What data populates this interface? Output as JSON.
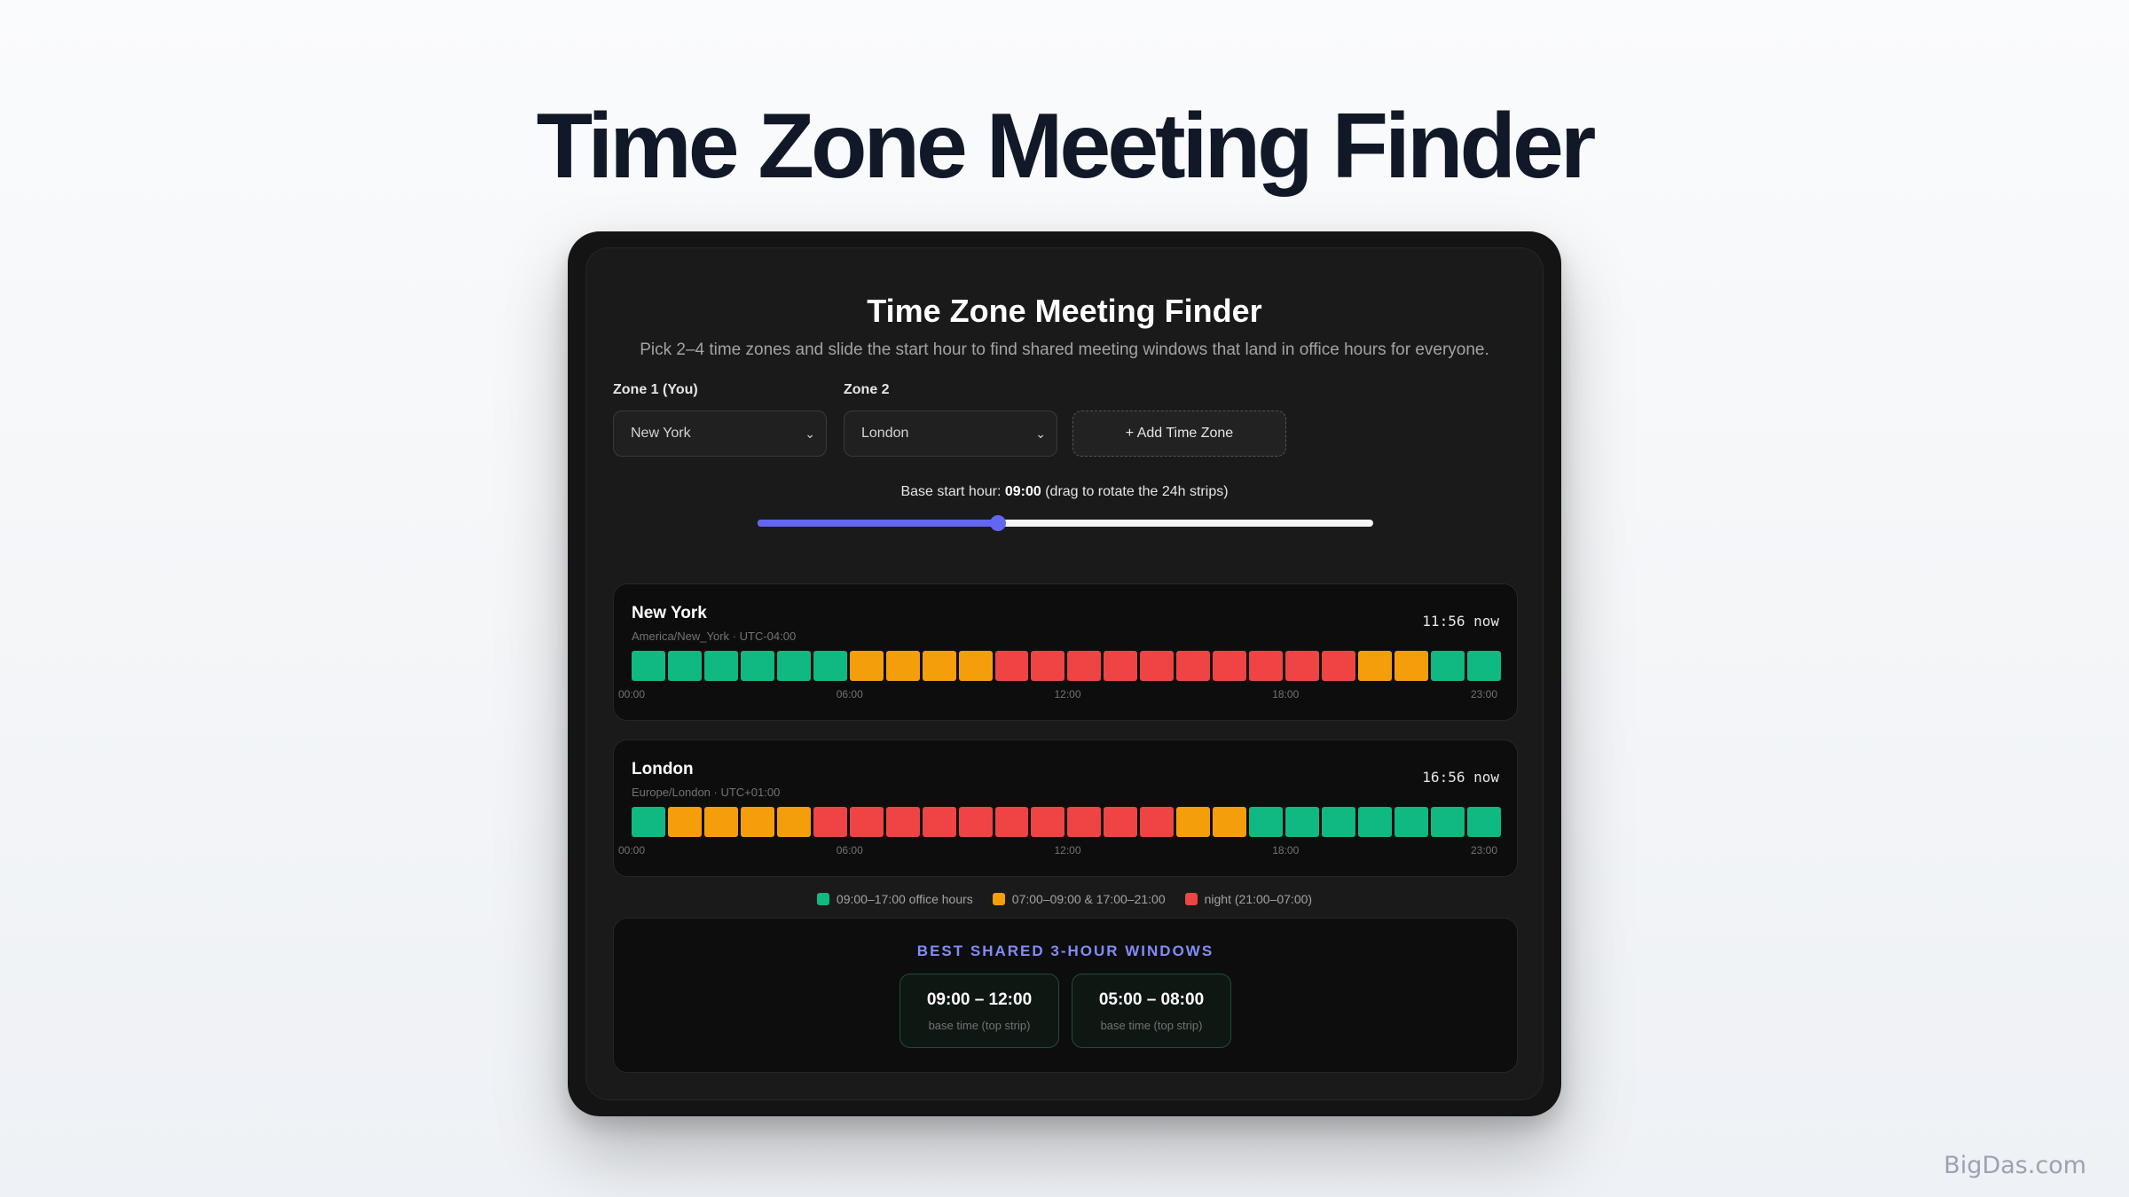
{
  "page": {
    "title": "Time Zone Meeting Finder",
    "watermark": "BigDas.com"
  },
  "app": {
    "title": "Time Zone Meeting Finder",
    "subtitle": "Pick 2–4 time zones and slide the start hour to find shared meeting windows that land in office hours for everyone."
  },
  "controls": {
    "zone1": {
      "label": "Zone 1 (You)",
      "value": "New York"
    },
    "zone2": {
      "label": "Zone 2",
      "value": "London"
    },
    "add_label": "+ Add Time Zone",
    "base_prefix": "Base start hour: ",
    "base_value": "09:00",
    "base_suffix": " (drag to rotate the 24h strips)",
    "slider_fraction": 0.39
  },
  "colors": {
    "office": "#10b981",
    "edge": "#f59e0b",
    "night": "#ef4444",
    "accent": "#6366f1"
  },
  "zones": [
    {
      "name": "New York",
      "meta": "America/New_York · UTC-04:00",
      "now": "11:56 now",
      "hours": [
        "office",
        "office",
        "office",
        "office",
        "office",
        "office",
        "edge",
        "edge",
        "edge",
        "edge",
        "night",
        "night",
        "night",
        "night",
        "night",
        "night",
        "night",
        "night",
        "night",
        "night",
        "edge",
        "edge",
        "office",
        "office"
      ],
      "ticks": [
        "00:00",
        "06:00",
        "12:00",
        "18:00",
        "23:00"
      ]
    },
    {
      "name": "London",
      "meta": "Europe/London · UTC+01:00",
      "now": "16:56 now",
      "hours": [
        "office",
        "edge",
        "edge",
        "edge",
        "edge",
        "night",
        "night",
        "night",
        "night",
        "night",
        "night",
        "night",
        "night",
        "night",
        "night",
        "edge",
        "edge",
        "office",
        "office",
        "office",
        "office",
        "office",
        "office",
        "office"
      ],
      "ticks": [
        "00:00",
        "06:00",
        "12:00",
        "18:00",
        "23:00"
      ]
    }
  ],
  "legend": [
    {
      "key": "office",
      "label": "09:00–17:00 office hours"
    },
    {
      "key": "edge",
      "label": "07:00–09:00 & 17:00–21:00"
    },
    {
      "key": "night",
      "label": "night (21:00–07:00)"
    }
  ],
  "best": {
    "title": "BEST SHARED 3-HOUR WINDOWS",
    "windows": [
      {
        "time": "09:00 – 12:00",
        "note": "base time (top strip)"
      },
      {
        "time": "05:00 – 08:00",
        "note": "base time (top strip)"
      }
    ]
  }
}
